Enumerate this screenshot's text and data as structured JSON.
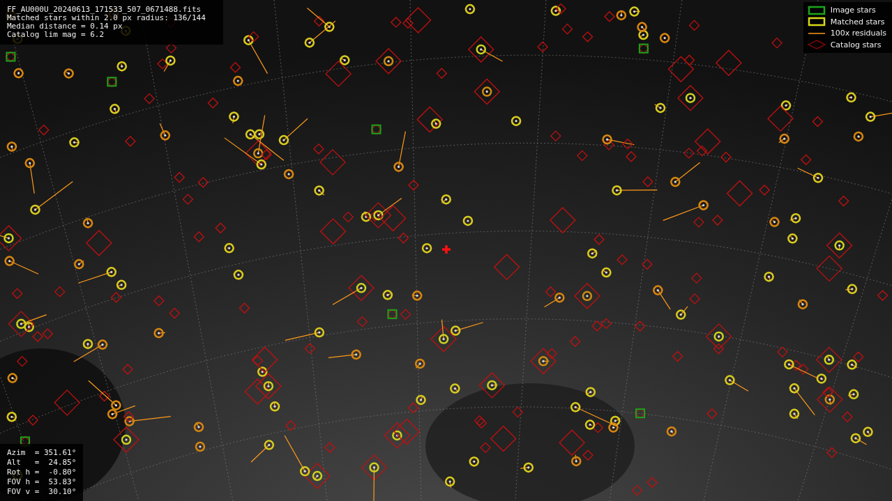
{
  "header": {
    "lines": [
      "FF_AU000U_20240613_171533_507_0671488.fits",
      "Matched stars within 2.0 px radius: 136/144",
      "Median distance = 0.14 px",
      "Catalog lim mag = 6.2"
    ]
  },
  "legend": [
    {
      "kind": "image",
      "label": "Image stars"
    },
    {
      "kind": "matched",
      "label": "Matched stars"
    },
    {
      "kind": "residual",
      "label": "100x residuals"
    },
    {
      "kind": "catalog",
      "label": "Catalog stars"
    }
  ],
  "pointing": [
    "Azim  = 351.61°",
    "Alt   =  24.85°",
    "Rot h =  -0.80°",
    "FOV h =  53.83°",
    "FOV v =  30.10°"
  ]
}
